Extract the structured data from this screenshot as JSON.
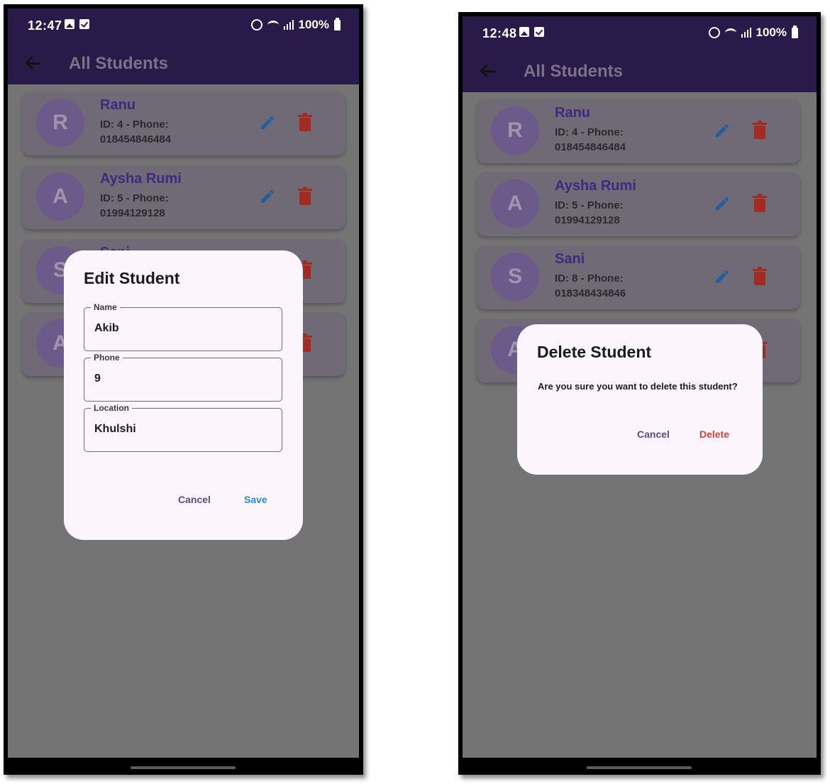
{
  "left": {
    "status": {
      "time": "12:47",
      "battery": "100%"
    },
    "appbar": {
      "title": "All Students"
    },
    "students": [
      {
        "initial": "R",
        "name": "Ranu",
        "detail": "ID: 4 - Phone: 018454846484"
      },
      {
        "initial": "A",
        "name": "Aysha Rumi",
        "detail": "ID: 5 - Phone: 01994129128"
      },
      {
        "initial": "S",
        "name": "Sani",
        "detail": ""
      },
      {
        "initial": "A",
        "name": "",
        "detail": ""
      }
    ],
    "dialog": {
      "title": "Edit Student",
      "fields": [
        {
          "label": "Name",
          "value": "Akib"
        },
        {
          "label": "Phone",
          "value": "9"
        },
        {
          "label": "Location",
          "value": "Khulshi"
        }
      ],
      "cancel": "Cancel",
      "save": "Save"
    }
  },
  "right": {
    "status": {
      "time": "12:48",
      "battery": "100%"
    },
    "appbar": {
      "title": "All Students"
    },
    "students": [
      {
        "initial": "R",
        "name": "Ranu",
        "detail": "ID: 4 - Phone: 018454846484"
      },
      {
        "initial": "A",
        "name": "Aysha Rumi",
        "detail": "ID: 5 - Phone: 01994129128"
      },
      {
        "initial": "S",
        "name": "Sani",
        "detail": "ID: 8 - Phone: 018348434846"
      },
      {
        "initial": "A",
        "name": "",
        "detail": ""
      }
    ],
    "dialog": {
      "title": "Delete Student",
      "message": "Are you sure you want to delete this student?",
      "cancel": "Cancel",
      "delete": "Delete"
    }
  },
  "colors": {
    "appbar": "#2a1a4a",
    "scrim": "#747474",
    "name_text": "#3f2a80",
    "edit_icon": "#1f5f9f",
    "delete_icon": "#a32b22",
    "save_button": "#2a8ad8",
    "delete_button": "#d9423a",
    "cancel_button": "#5a4a8a"
  }
}
